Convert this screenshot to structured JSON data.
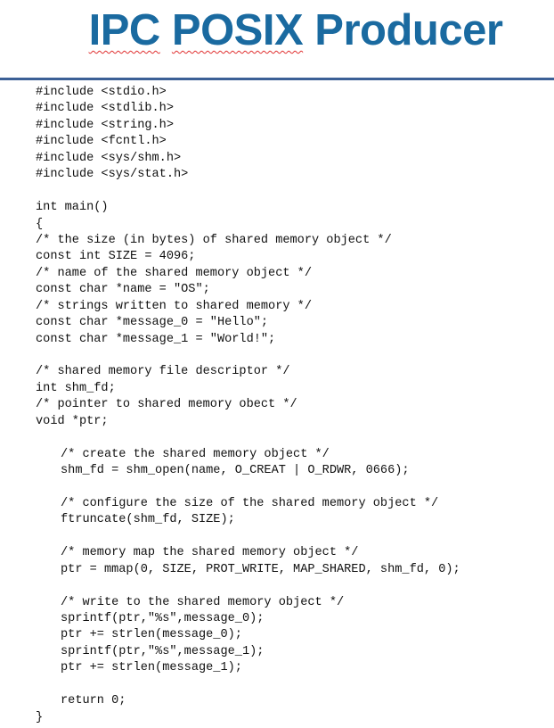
{
  "slide": {
    "title_words": [
      "IPC",
      "POSIX",
      "Producer"
    ],
    "accent_color": "#1a6aa0",
    "code_lines": [
      {
        "text": "#include <stdio.h>",
        "indent": 0
      },
      {
        "text": "#include <stdlib.h>",
        "indent": 0
      },
      {
        "text": "#include <string.h>",
        "indent": 0
      },
      {
        "text": "#include <fcntl.h>",
        "indent": 0
      },
      {
        "text": "#include <sys/shm.h>",
        "indent": 0
      },
      {
        "text": "#include <sys/stat.h>",
        "indent": 0
      },
      {
        "text": "",
        "indent": 0
      },
      {
        "text": "int main()",
        "indent": 0
      },
      {
        "text": "{",
        "indent": 0
      },
      {
        "text": "/* the size (in bytes) of shared memory object */",
        "indent": 0
      },
      {
        "text": "const int SIZE = 4096;",
        "indent": 0
      },
      {
        "text": "/* name of the shared memory object */",
        "indent": 0
      },
      {
        "text": "const char *name = \"OS\";",
        "indent": 0
      },
      {
        "text": "/* strings written to shared memory */",
        "indent": 0
      },
      {
        "text": "const char *message_0 = \"Hello\";",
        "indent": 0
      },
      {
        "text": "const char *message_1 = \"World!\";",
        "indent": 0
      },
      {
        "text": "",
        "indent": 0
      },
      {
        "text": "/* shared memory file descriptor */",
        "indent": 0
      },
      {
        "text": "int shm_fd;",
        "indent": 0
      },
      {
        "text": "/* pointer to shared memory obect */",
        "indent": 0
      },
      {
        "text": "void *ptr;",
        "indent": 0
      },
      {
        "text": "",
        "indent": 0
      },
      {
        "text": "/* create the shared memory object */",
        "indent": 1
      },
      {
        "text": "shm_fd = shm_open(name, O_CREAT | O_RDWR, 0666);",
        "indent": 1
      },
      {
        "text": "",
        "indent": 0
      },
      {
        "text": "/* configure the size of the shared memory object */",
        "indent": 1
      },
      {
        "text": "ftruncate(shm_fd, SIZE);",
        "indent": 1
      },
      {
        "text": "",
        "indent": 0
      },
      {
        "text": "/* memory map the shared memory object */",
        "indent": 1
      },
      {
        "text": "ptr = mmap(0, SIZE, PROT_WRITE, MAP_SHARED, shm_fd, 0);",
        "indent": 1
      },
      {
        "text": "",
        "indent": 0
      },
      {
        "text": "/* write to the shared memory object */",
        "indent": 1
      },
      {
        "text": "sprintf(ptr,\"%s\",message_0);",
        "indent": 1
      },
      {
        "text": "ptr += strlen(message_0);",
        "indent": 1
      },
      {
        "text": "sprintf(ptr,\"%s\",message_1);",
        "indent": 1
      },
      {
        "text": "ptr += strlen(message_1);",
        "indent": 1
      },
      {
        "text": "",
        "indent": 0
      },
      {
        "text": "return 0;",
        "indent": 1
      },
      {
        "text": "}",
        "indent": 0
      }
    ]
  }
}
